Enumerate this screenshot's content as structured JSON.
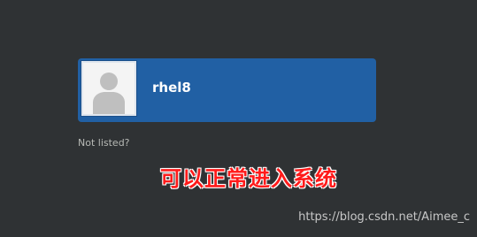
{
  "login": {
    "user": {
      "name": "rhel8"
    },
    "not_listed_label": "Not listed?"
  },
  "annotation": {
    "text": "可以正常进入系统",
    "color": "#ff1a1a"
  },
  "watermark": {
    "text": "https://blog.csdn.net/Aimee_c"
  },
  "colors": {
    "background": "#2f3234",
    "selected_user_card": "#2160a4",
    "avatar_background": "#f4f4f4"
  },
  "icons": {
    "avatar": "user-silhouette-icon"
  }
}
